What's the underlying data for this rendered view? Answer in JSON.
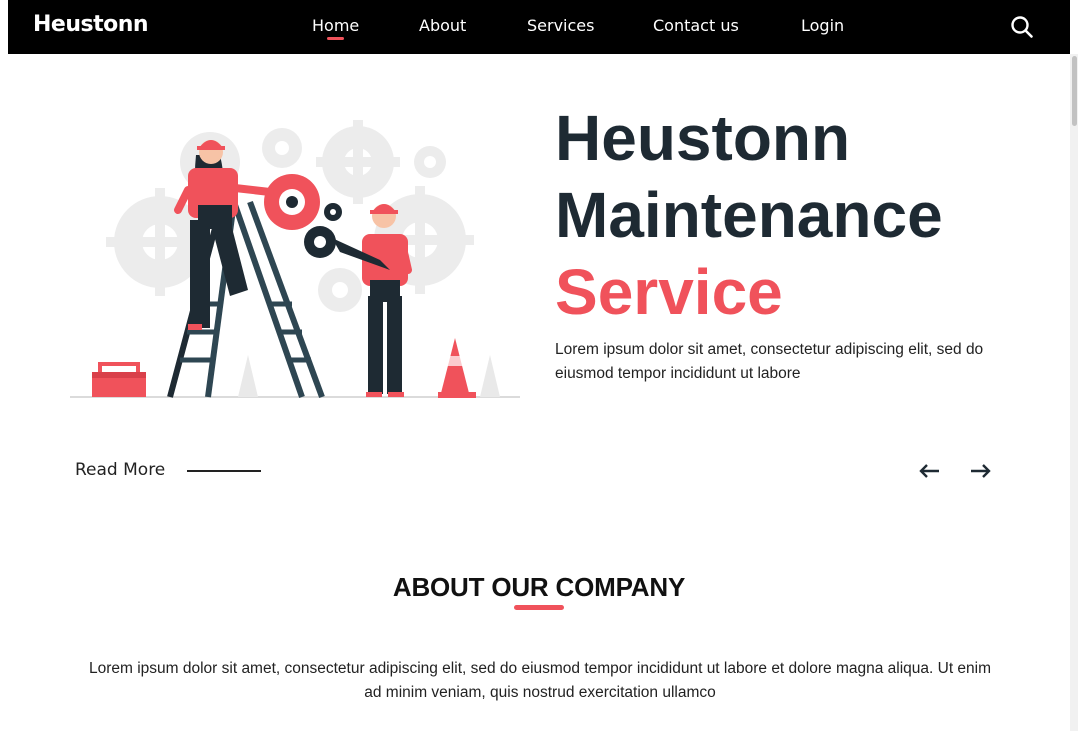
{
  "nav": {
    "brand": "Heustonn",
    "items": [
      {
        "label": "Home"
      },
      {
        "label": "About"
      },
      {
        "label": "Services"
      },
      {
        "label": "Contact us"
      },
      {
        "label": "Login"
      }
    ],
    "active_index": 0,
    "search_icon": "search-icon"
  },
  "hero": {
    "title_line1": "Heustonn",
    "title_line2": "Maintenance",
    "title_line3": "Service",
    "description": "Lorem ipsum dolor sit amet, consectetur adipiscing elit, sed do eiusmod tempor incididunt ut labore",
    "read_more": "Read More",
    "prev_icon": "arrow-left-icon",
    "next_icon": "arrow-right-icon",
    "illustration": "maintenance-workers-illustration"
  },
  "about": {
    "title": "ABOUT OUR COMPANY",
    "text": "Lorem ipsum dolor sit amet, consectetur adipiscing elit, sed do eiusmod tempor incididunt ut labore et dolore magna aliqua. Ut enim ad minim veniam, quis nostrud exercitation ullamco"
  },
  "colors": {
    "accent": "#f0525b",
    "dark": "#1e2a33",
    "nav_bg": "#000000"
  }
}
